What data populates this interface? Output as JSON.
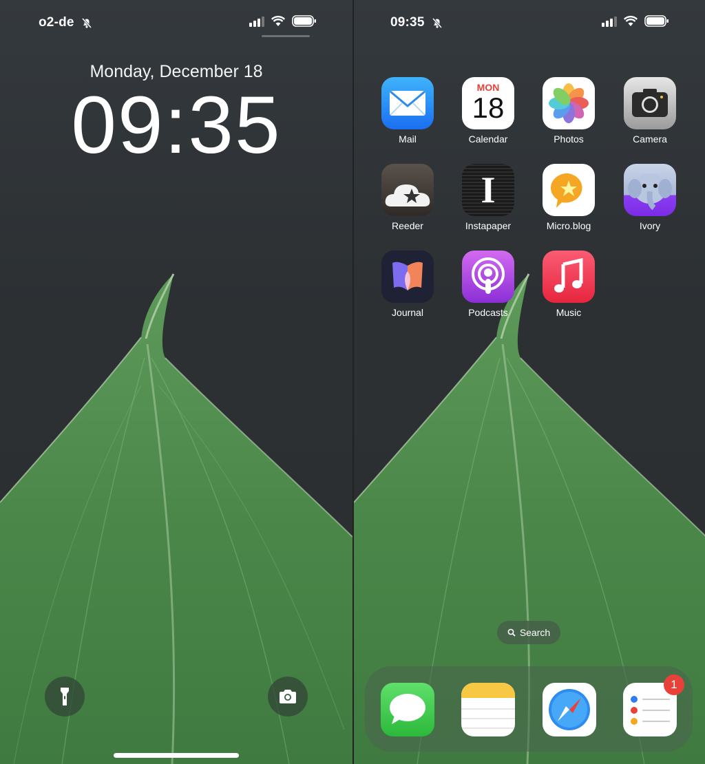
{
  "lock_screen": {
    "carrier": "o2-de",
    "date": "Monday, December 18",
    "time": "09:35"
  },
  "home_screen": {
    "status_time": "09:35",
    "apps": [
      {
        "label": "Mail",
        "icon": "mail-icon"
      },
      {
        "label": "Calendar",
        "icon": "calendar-icon",
        "day_abbrev": "MON",
        "day_number": "18"
      },
      {
        "label": "Photos",
        "icon": "photos-icon"
      },
      {
        "label": "Camera",
        "icon": "camera-icon"
      },
      {
        "label": "Reeder",
        "icon": "reeder-icon"
      },
      {
        "label": "Instapaper",
        "icon": "instapaper-icon",
        "glyph": "I"
      },
      {
        "label": "Micro.blog",
        "icon": "microblog-icon"
      },
      {
        "label": "Ivory",
        "icon": "ivory-icon"
      },
      {
        "label": "Journal",
        "icon": "journal-icon"
      },
      {
        "label": "Podcasts",
        "icon": "podcasts-icon"
      },
      {
        "label": "Music",
        "icon": "music-icon"
      }
    ],
    "search_label": "Search",
    "dock": [
      {
        "app": "Messages",
        "icon": "messages-icon"
      },
      {
        "app": "Notes",
        "icon": "notes-icon"
      },
      {
        "app": "Safari",
        "icon": "safari-icon"
      },
      {
        "app": "Reminders",
        "icon": "reminders-icon",
        "badge": "1"
      }
    ]
  },
  "colors": {
    "leaf": "#4f8a4f",
    "background": "#2f3336",
    "badge": "#e8413a"
  }
}
